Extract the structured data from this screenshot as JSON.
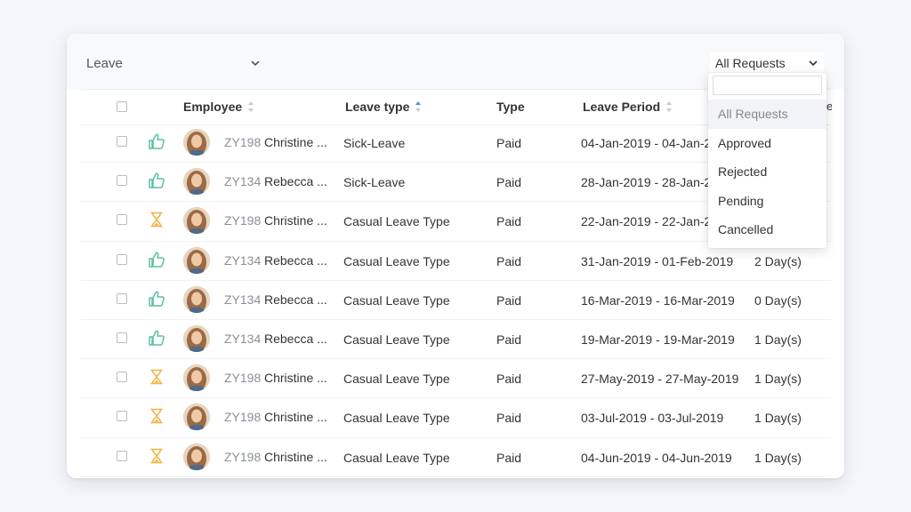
{
  "leave_filter": {
    "label": "Leave"
  },
  "request_filter": {
    "label": "All Requests"
  },
  "table": {
    "headers": {
      "employee": "Employee",
      "leave_type": "Leave type",
      "type": "Type",
      "leave_period": "Leave Period"
    },
    "rows": [
      {
        "status": "approved",
        "id": "ZY198",
        "name": "Christine ...",
        "leave_type": "Sick-Leave",
        "type": "Paid",
        "period": "04-Jan-2019 - 04-Jan-20",
        "days": ""
      },
      {
        "status": "approved",
        "id": "ZY134",
        "name": "Rebecca ...",
        "leave_type": "Sick-Leave",
        "type": "Paid",
        "period": "28-Jan-2019 - 28-Jan-20",
        "days": ""
      },
      {
        "status": "pending",
        "id": "ZY198",
        "name": "Christine ...",
        "leave_type": "Casual Leave Type",
        "type": "Paid",
        "period": "22-Jan-2019 - 22-Jan-20",
        "days": ""
      },
      {
        "status": "approved",
        "id": "ZY134",
        "name": "Rebecca ...",
        "leave_type": "Casual Leave Type",
        "type": "Paid",
        "period": "31-Jan-2019 - 01-Feb-2019",
        "days": "2 Day(s)"
      },
      {
        "status": "approved",
        "id": "ZY134",
        "name": "Rebecca ...",
        "leave_type": "Casual Leave Type",
        "type": "Paid",
        "period": "16-Mar-2019 - 16-Mar-2019",
        "days": "0 Day(s)"
      },
      {
        "status": "approved",
        "id": "ZY134",
        "name": "Rebecca ...",
        "leave_type": "Casual Leave Type",
        "type": "Paid",
        "period": "19-Mar-2019 - 19-Mar-2019",
        "days": "1 Day(s)"
      },
      {
        "status": "pending",
        "id": "ZY198",
        "name": "Christine ...",
        "leave_type": "Casual Leave Type",
        "type": "Paid",
        "period": "27-May-2019 - 27-May-2019",
        "days": "1 Day(s)"
      },
      {
        "status": "pending",
        "id": "ZY198",
        "name": "Christine ...",
        "leave_type": "Casual Leave Type",
        "type": "Paid",
        "period": "03-Jul-2019 - 03-Jul-2019",
        "days": "1 Day(s)"
      },
      {
        "status": "pending",
        "id": "ZY198",
        "name": "Christine ...",
        "leave_type": "Casual Leave Type",
        "type": "Paid",
        "period": "04-Jun-2019 - 04-Jun-2019",
        "days": "1 Day(s)"
      }
    ]
  },
  "dropdown": {
    "search_value": "",
    "options": [
      "All Requests",
      "Approved",
      "Rejected",
      "Pending",
      "Cancelled"
    ],
    "active_index": 0
  },
  "icons": {
    "approved": "thumbs-up-icon",
    "pending": "hourglass-icon"
  },
  "colors": {
    "approved": "#5bbfa3",
    "pending": "#f0b547",
    "sort_active": "#4f8ee8"
  }
}
